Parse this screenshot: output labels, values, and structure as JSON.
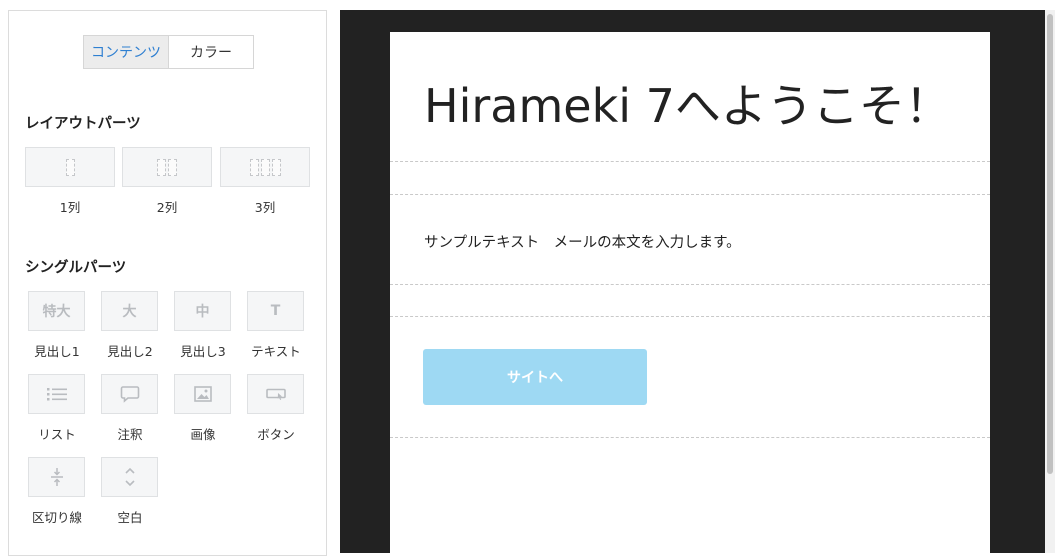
{
  "tabs": {
    "contents": "コンテンツ",
    "color": "カラー"
  },
  "layout_section": {
    "title": "レイアウトパーツ",
    "items": [
      {
        "label": "1列",
        "columns": 1
      },
      {
        "label": "2列",
        "columns": 2
      },
      {
        "label": "3列",
        "columns": 3
      }
    ]
  },
  "single_section": {
    "title": "シングルパーツ",
    "items": [
      {
        "label": "見出し1",
        "glyph": "特大",
        "icon": "heading-xl-icon"
      },
      {
        "label": "見出し2",
        "glyph": "大",
        "icon": "heading-l-icon"
      },
      {
        "label": "見出し3",
        "glyph": "中",
        "icon": "heading-m-icon"
      },
      {
        "label": "テキスト",
        "glyph": "T",
        "icon": "text-icon"
      },
      {
        "label": "リスト",
        "icon": "list-icon"
      },
      {
        "label": "注釈",
        "icon": "speech-bubble-icon"
      },
      {
        "label": "画像",
        "icon": "image-icon"
      },
      {
        "label": "ボタン",
        "icon": "button-icon"
      },
      {
        "label": "区切り線",
        "icon": "divider-icon"
      },
      {
        "label": "空白",
        "icon": "spacer-icon"
      }
    ]
  },
  "mail": {
    "heading": "Hirameki 7へようこそ！",
    "body": "サンプルテキスト　メールの本文を入力します。",
    "button_label": "サイトへ",
    "button_color": "#9ed9f3"
  }
}
